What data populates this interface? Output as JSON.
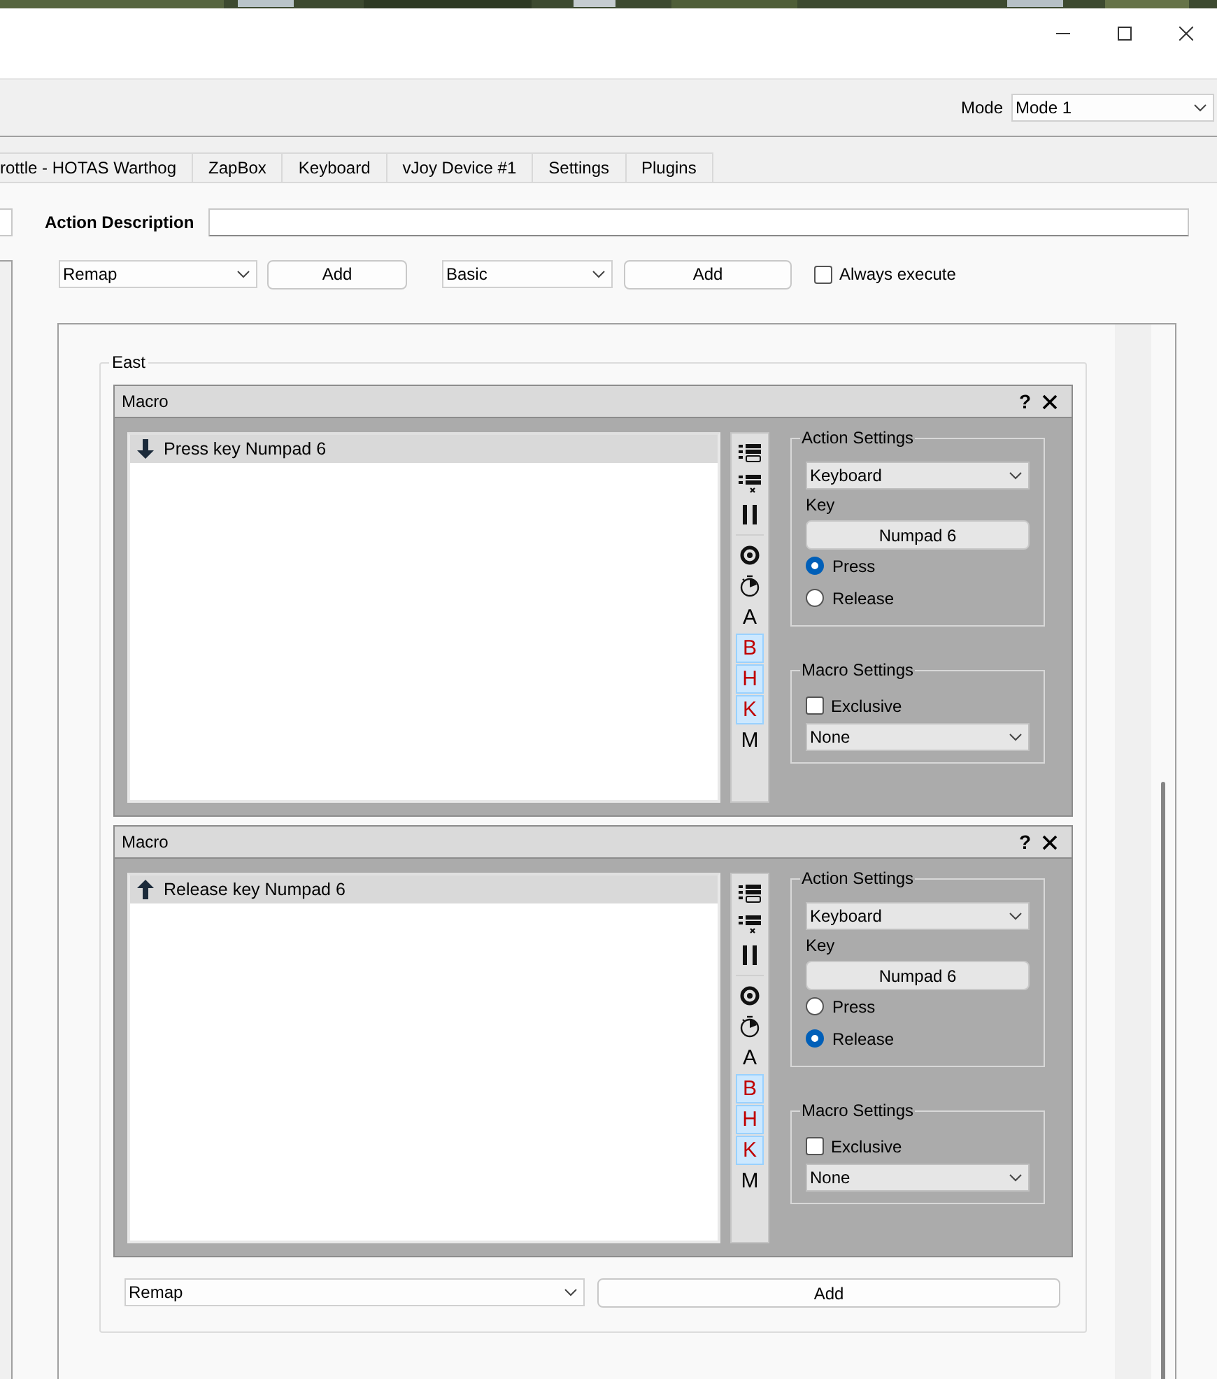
{
  "mode": {
    "label": "Mode",
    "value": "Mode 1"
  },
  "tabs": [
    {
      "label": "rottle - HOTAS Warthog",
      "selected": false
    },
    {
      "label": "ZapBox",
      "selected": false
    },
    {
      "label": "Keyboard",
      "selected": false
    },
    {
      "label": "vJoy Device #1",
      "selected": false
    },
    {
      "label": "Settings",
      "selected": false
    },
    {
      "label": "Plugins",
      "selected": false
    }
  ],
  "action_description": {
    "label": "Action Description"
  },
  "action_row": {
    "action_type": "Remap",
    "add_action": "Add",
    "container_type": "Basic",
    "add_container": "Add",
    "always_execute": {
      "label": "Always execute",
      "checked": false
    }
  },
  "group": {
    "title": "East",
    "macros": [
      {
        "title": "Macro",
        "help": "?",
        "actions": [
          {
            "kind": "press",
            "label": "Press key Numpad 6",
            "selected": true
          }
        ],
        "tools": [
          {
            "kind": "list-add"
          },
          {
            "kind": "list-remove"
          },
          {
            "kind": "pause"
          },
          {
            "kind": "divider"
          },
          {
            "kind": "record"
          },
          {
            "kind": "timer"
          },
          {
            "kind": "letter",
            "label": "A",
            "on": false
          },
          {
            "kind": "letter",
            "label": "B",
            "on": true
          },
          {
            "kind": "letter",
            "label": "H",
            "on": true
          },
          {
            "kind": "letter",
            "label": "K",
            "on": true
          },
          {
            "kind": "letter",
            "label": "M",
            "on": false
          }
        ],
        "action_settings": {
          "title": "Action Settings",
          "device": "Keyboard",
          "key_label": "Key",
          "key": "Numpad 6",
          "modes": [
            {
              "label": "Press",
              "selected": true
            },
            {
              "label": "Release",
              "selected": false
            }
          ]
        },
        "macro_settings": {
          "title": "Macro Settings",
          "exclusive": {
            "label": "Exclusive",
            "checked": false
          },
          "mode": "None"
        }
      },
      {
        "title": "Macro",
        "help": "?",
        "actions": [
          {
            "kind": "release",
            "label": "Release key Numpad 6",
            "selected": true
          }
        ],
        "tools": [
          {
            "kind": "list-add"
          },
          {
            "kind": "list-remove"
          },
          {
            "kind": "pause"
          },
          {
            "kind": "divider"
          },
          {
            "kind": "record"
          },
          {
            "kind": "timer"
          },
          {
            "kind": "letter",
            "label": "A",
            "on": false
          },
          {
            "kind": "letter",
            "label": "B",
            "on": true
          },
          {
            "kind": "letter",
            "label": "H",
            "on": true
          },
          {
            "kind": "letter",
            "label": "K",
            "on": true
          },
          {
            "kind": "letter",
            "label": "M",
            "on": false
          }
        ],
        "action_settings": {
          "title": "Action Settings",
          "device": "Keyboard",
          "key_label": "Key",
          "key": "Numpad 6",
          "modes": [
            {
              "label": "Press",
              "selected": false
            },
            {
              "label": "Release",
              "selected": true
            }
          ]
        },
        "macro_settings": {
          "title": "Macro Settings",
          "exclusive": {
            "label": "Exclusive",
            "checked": false
          },
          "mode": "None"
        }
      }
    ],
    "footer": {
      "action_type": "Remap",
      "add": "Add"
    }
  }
}
